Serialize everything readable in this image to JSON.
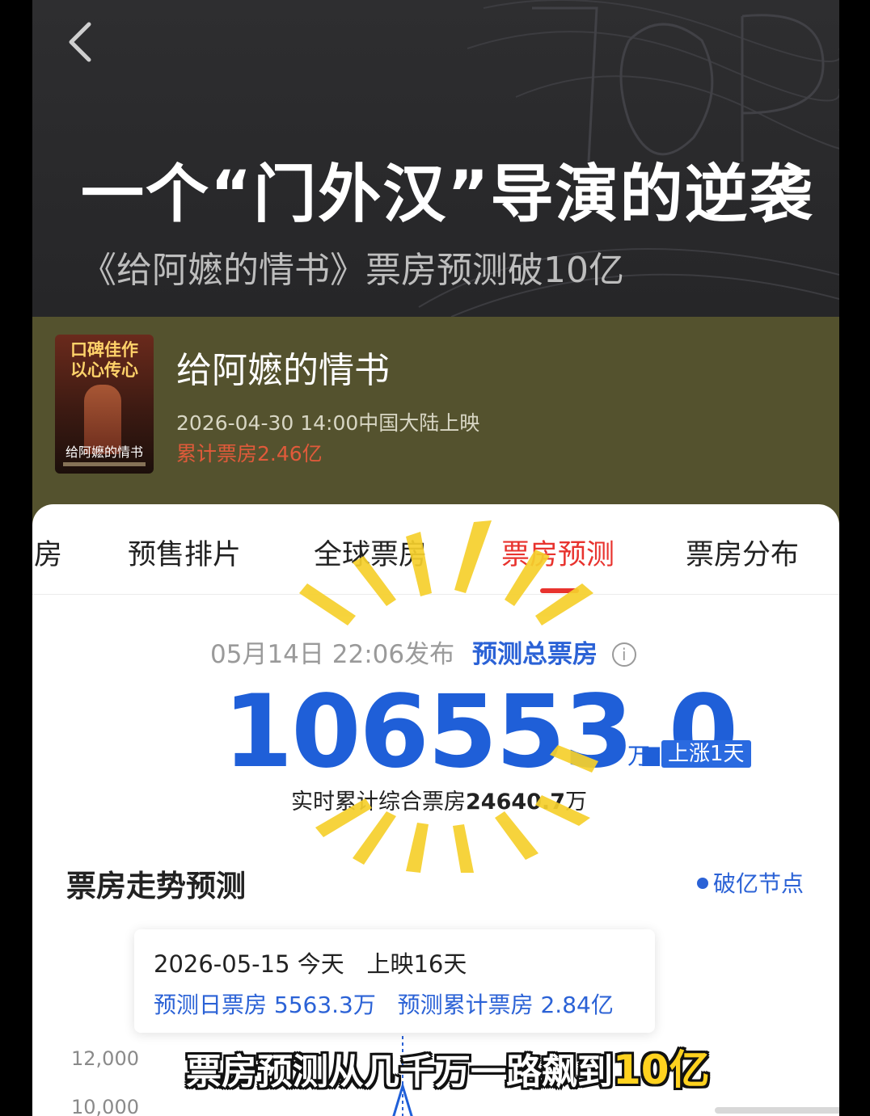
{
  "banner": {
    "title": "一个“门外汉”导演的逆袭",
    "subtitle": "《给阿嬷的情书》票房预测破10亿"
  },
  "movie": {
    "poster_slogan_line1": "口碑佳作",
    "poster_slogan_line2": "以心传心",
    "poster_title": "给阿嬷的情书",
    "title": "给阿嬷的情书",
    "release": "2026-04-30 14:00中国大陆上映",
    "cumulative_box": "累计票房2.46亿"
  },
  "tabs": [
    {
      "label": "房"
    },
    {
      "label": "预售排片"
    },
    {
      "label": "全球票房"
    },
    {
      "label": "票房预测",
      "active": true
    },
    {
      "label": "票房分布"
    }
  ],
  "forecast": {
    "published": "05月14日 22:06发布",
    "label": "预测总票房",
    "info_icon": "i",
    "total": "106553.0",
    "unit": "万",
    "badge": "上涨1天",
    "realtime_prefix": "实时累计综合票房",
    "realtime_value": "24640.7",
    "realtime_unit": "万"
  },
  "trend": {
    "title": "票房走势预测",
    "legend": "破亿节点",
    "tooltip": {
      "date": "2026-05-15",
      "today": "今天",
      "days": "上映16天",
      "daily": "预测日票房 5563.3万",
      "cumulative": "预测累计票房 2.84亿"
    },
    "y_ticks": [
      "12,000",
      "10,000"
    ]
  },
  "caption": {
    "text": "票房预测从几千万一路飙到",
    "highlight": "10亿"
  },
  "colors": {
    "accent_blue": "#1f5fd8",
    "accent_red": "#e8332e",
    "banner_bg": "#2a2a2c",
    "movie_bg": "#54522e",
    "ray_yellow": "#f6d02c"
  }
}
